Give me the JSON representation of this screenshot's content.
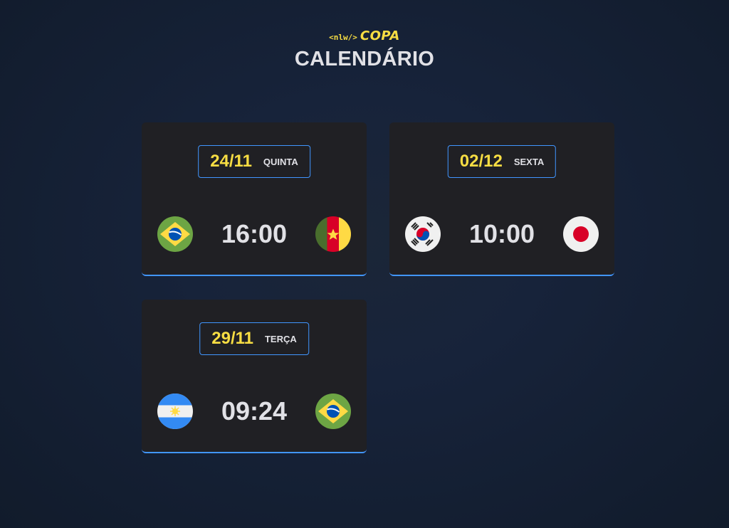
{
  "header": {
    "logo_tag": "<nlw/>",
    "logo_name": "COPA",
    "title": "CALENDÁRIO"
  },
  "cards": [
    {
      "date": "24/11",
      "weekday": "QUINTA",
      "time": "16:00",
      "home_flag": "brazil-flag",
      "away_flag": "cameroon-flag"
    },
    {
      "date": "02/12",
      "weekday": "SEXTA",
      "time": "10:00",
      "home_flag": "south-korea-flag",
      "away_flag": "japan-flag"
    },
    {
      "date": "29/11",
      "weekday": "TERÇA",
      "time": "09:24",
      "home_flag": "argentina-flag",
      "away_flag": "brazil-flag"
    }
  ],
  "colors": {
    "accent_yellow": "#f7dd43",
    "accent_blue": "#4196ff",
    "card_bg": "#202024",
    "text": "#e1e1e6"
  }
}
